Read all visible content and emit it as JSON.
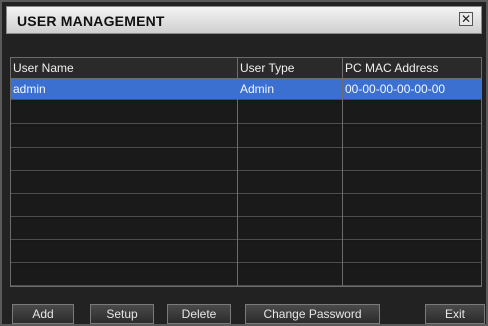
{
  "window": {
    "title": "USER MANAGEMENT",
    "close_glyph": "✕"
  },
  "table": {
    "columns": [
      "User Name",
      "User Type",
      "PC MAC Address"
    ],
    "rows": [
      {
        "user_name": "admin",
        "user_type": "Admin",
        "mac": "00-00-00-00-00-00"
      }
    ],
    "selected_row_color": "#3b6fd0"
  },
  "buttons": {
    "add": "Add",
    "setup": "Setup",
    "delete": "Delete",
    "change_password": "Change Password",
    "exit": "Exit"
  }
}
